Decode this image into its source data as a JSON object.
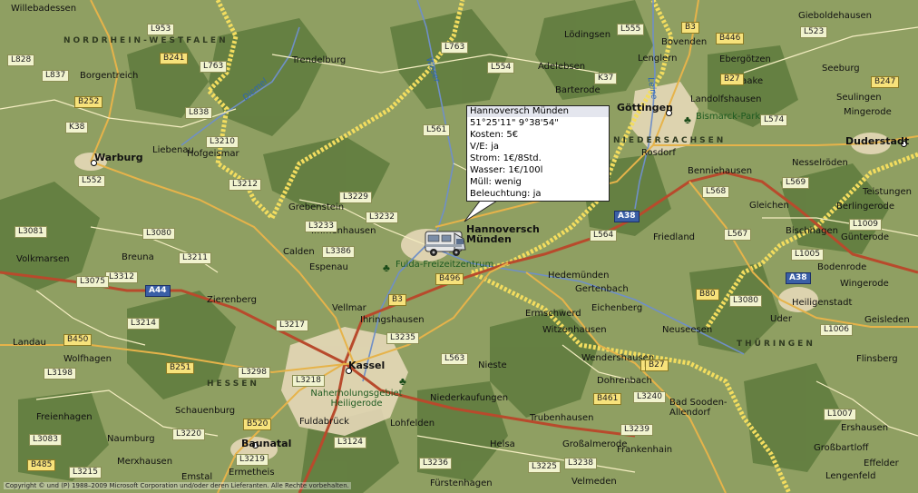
{
  "map": {
    "colors": {
      "lowland": "#8f9f62",
      "forest": "#5e7a3d",
      "urban": "#e6d8b8",
      "highway": "#b84a2c",
      "main_road": "#e6b34a",
      "minor_road": "#f5eec2",
      "river": "#6f8fc7",
      "border": "#f3dd5f"
    },
    "regions": [
      "NORDRHEIN-WESTFALEN",
      "NIEDERSACHSEN",
      "HESSEN",
      "THÜRINGEN"
    ],
    "cities": [
      {
        "name": "Willebadessen",
        "kind": "town"
      },
      {
        "name": "Borgentreich",
        "kind": "town"
      },
      {
        "name": "Trendelburg",
        "kind": "town"
      },
      {
        "name": "Liebenau",
        "kind": "town"
      },
      {
        "name": "Warburg",
        "kind": "city"
      },
      {
        "name": "Hofgeismar",
        "kind": "town"
      },
      {
        "name": "Grebenstein",
        "kind": "town"
      },
      {
        "name": "Immenhausen",
        "kind": "town"
      },
      {
        "name": "Calden",
        "kind": "town"
      },
      {
        "name": "Espenau",
        "kind": "town"
      },
      {
        "name": "Volkmarsen",
        "kind": "town"
      },
      {
        "name": "Breuna",
        "kind": "town"
      },
      {
        "name": "Zierenberg",
        "kind": "town"
      },
      {
        "name": "Vellmar",
        "kind": "town"
      },
      {
        "name": "Ihringshausen",
        "kind": "town"
      },
      {
        "name": "Landau",
        "kind": "town"
      },
      {
        "name": "Wolfhagen",
        "kind": "town"
      },
      {
        "name": "Kassel",
        "kind": "city"
      },
      {
        "name": "Niederkaufungen",
        "kind": "town"
      },
      {
        "name": "Nieste",
        "kind": "town"
      },
      {
        "name": "Freienhagen",
        "kind": "town"
      },
      {
        "name": "Schauenburg",
        "kind": "town"
      },
      {
        "name": "Fuldabrück",
        "kind": "town"
      },
      {
        "name": "Lohfelden",
        "kind": "town"
      },
      {
        "name": "Naumburg",
        "kind": "town"
      },
      {
        "name": "Baunatal",
        "kind": "city"
      },
      {
        "name": "Merxhausen",
        "kind": "town"
      },
      {
        "name": "Emstal",
        "kind": "town"
      },
      {
        "name": "Ermetheis",
        "kind": "town"
      },
      {
        "name": "Helsa",
        "kind": "town"
      },
      {
        "name": "Trubenhausen",
        "kind": "town"
      },
      {
        "name": "Großalmerode",
        "kind": "town"
      },
      {
        "name": "Fürstenhagen",
        "kind": "town"
      },
      {
        "name": "Velmeden",
        "kind": "town"
      },
      {
        "name": "Frankenhain",
        "kind": "town"
      },
      {
        "name": "Hannoversch Münden",
        "kind": "city"
      },
      {
        "name": "Hedemünden",
        "kind": "town"
      },
      {
        "name": "Gertenbach",
        "kind": "town"
      },
      {
        "name": "Ermschwerd",
        "kind": "town"
      },
      {
        "name": "Eichenberg",
        "kind": "town"
      },
      {
        "name": "Witzenhausen",
        "kind": "town"
      },
      {
        "name": "Wendershausen",
        "kind": "town"
      },
      {
        "name": "Dohrenbach",
        "kind": "town"
      },
      {
        "name": "Bad Sooden-Allendorf",
        "kind": "town"
      },
      {
        "name": "Neuseesen",
        "kind": "town"
      },
      {
        "name": "Friedland",
        "kind": "town"
      },
      {
        "name": "Rosdorf",
        "kind": "town"
      },
      {
        "name": "Göttingen",
        "kind": "city"
      },
      {
        "name": "Bovenden",
        "kind": "town"
      },
      {
        "name": "Lenglern",
        "kind": "town"
      },
      {
        "name": "Lödingsen",
        "kind": "town"
      },
      {
        "name": "Adelebsen",
        "kind": "town"
      },
      {
        "name": "Barterode",
        "kind": "town"
      },
      {
        "name": "Ebergötzen",
        "kind": "town"
      },
      {
        "name": "Waake",
        "kind": "town"
      },
      {
        "name": "Landolfshausen",
        "kind": "town"
      },
      {
        "name": "Gieboldehausen",
        "kind": "town"
      },
      {
        "name": "Seeburg",
        "kind": "town"
      },
      {
        "name": "Seulingen",
        "kind": "town"
      },
      {
        "name": "Mingerode",
        "kind": "town"
      },
      {
        "name": "Duderstadt",
        "kind": "city"
      },
      {
        "name": "Benniehausen",
        "kind": "town"
      },
      {
        "name": "Nesselröden",
        "kind": "town"
      },
      {
        "name": "Teistungen",
        "kind": "town"
      },
      {
        "name": "Gleichen",
        "kind": "town"
      },
      {
        "name": "Berlingerode",
        "kind": "town"
      },
      {
        "name": "Bischhagen",
        "kind": "town"
      },
      {
        "name": "Günterode",
        "kind": "town"
      },
      {
        "name": "Bodenrode",
        "kind": "town"
      },
      {
        "name": "Wingerode",
        "kind": "town"
      },
      {
        "name": "Heiligenstadt",
        "kind": "town"
      },
      {
        "name": "Uder",
        "kind": "town"
      },
      {
        "name": "Geisleden",
        "kind": "town"
      },
      {
        "name": "Flinsberg",
        "kind": "town"
      },
      {
        "name": "Ershausen",
        "kind": "town"
      },
      {
        "name": "Großbartloff",
        "kind": "town"
      },
      {
        "name": "Effelder",
        "kind": "town"
      },
      {
        "name": "Lengenfeld",
        "kind": "town"
      }
    ],
    "parks": [
      "Fulda-Freizeitzentrum",
      "Bismarck-Park",
      "Naherholungsgebiet Heiligerode"
    ],
    "rivers": [
      "Diemel",
      "Weser",
      "Leine"
    ],
    "shields": [
      {
        "text": "L953",
        "type": "l"
      },
      {
        "text": "K38",
        "type": "k"
      },
      {
        "text": "L828",
        "type": "l"
      },
      {
        "text": "B241",
        "type": "b"
      },
      {
        "text": "L837",
        "type": "l"
      },
      {
        "text": "B252",
        "type": "b"
      },
      {
        "text": "L838",
        "type": "l"
      },
      {
        "text": "L763",
        "type": "l"
      },
      {
        "text": "L3210",
        "type": "l"
      },
      {
        "text": "L552",
        "type": "l"
      },
      {
        "text": "L3212",
        "type": "l"
      },
      {
        "text": "L3229",
        "type": "l"
      },
      {
        "text": "L3232",
        "type": "l"
      },
      {
        "text": "L3233",
        "type": "l"
      },
      {
        "text": "L3081",
        "type": "l"
      },
      {
        "text": "L3080",
        "type": "l"
      },
      {
        "text": "L3386",
        "type": "l"
      },
      {
        "text": "L3211",
        "type": "l"
      },
      {
        "text": "L3312",
        "type": "l"
      },
      {
        "text": "L3075",
        "type": "l"
      },
      {
        "text": "A44",
        "type": "a"
      },
      {
        "text": "B3",
        "type": "b"
      },
      {
        "text": "L3214",
        "type": "l"
      },
      {
        "text": "L3217",
        "type": "l"
      },
      {
        "text": "B450",
        "type": "b"
      },
      {
        "text": "L3235",
        "type": "l"
      },
      {
        "text": "L3198",
        "type": "l"
      },
      {
        "text": "B251",
        "type": "b"
      },
      {
        "text": "L3298",
        "type": "l"
      },
      {
        "text": "L3218",
        "type": "l"
      },
      {
        "text": "B520",
        "type": "b"
      },
      {
        "text": "L3220",
        "type": "l"
      },
      {
        "text": "L3083",
        "type": "l"
      },
      {
        "text": "B485",
        "type": "b"
      },
      {
        "text": "L3219",
        "type": "l"
      },
      {
        "text": "L3215",
        "type": "l"
      },
      {
        "text": "L3124",
        "type": "l"
      },
      {
        "text": "L3236",
        "type": "l"
      },
      {
        "text": "L3225",
        "type": "l"
      },
      {
        "text": "L3238",
        "type": "l"
      },
      {
        "text": "L3239",
        "type": "l"
      },
      {
        "text": "B461",
        "type": "b"
      },
      {
        "text": "L3240",
        "type": "l"
      },
      {
        "text": "B27",
        "type": "b"
      },
      {
        "text": "L563",
        "type": "l"
      },
      {
        "text": "B496",
        "type": "b"
      },
      {
        "text": "L561",
        "type": "l"
      },
      {
        "text": "L554",
        "type": "l"
      },
      {
        "text": "K37",
        "type": "k"
      },
      {
        "text": "L555",
        "type": "l"
      },
      {
        "text": "B3",
        "type": "b"
      },
      {
        "text": "B446",
        "type": "b"
      },
      {
        "text": "L523",
        "type": "l"
      },
      {
        "text": "B27",
        "type": "b"
      },
      {
        "text": "L574",
        "type": "l"
      },
      {
        "text": "B247",
        "type": "b"
      },
      {
        "text": "L568",
        "type": "l"
      },
      {
        "text": "L569",
        "type": "l"
      },
      {
        "text": "A38",
        "type": "a"
      },
      {
        "text": "L564",
        "type": "l"
      },
      {
        "text": "L567",
        "type": "l"
      },
      {
        "text": "L1009",
        "type": "l"
      },
      {
        "text": "L1005",
        "type": "l"
      },
      {
        "text": "A38",
        "type": "a"
      },
      {
        "text": "B80",
        "type": "b"
      },
      {
        "text": "L3080",
        "type": "l"
      },
      {
        "text": "L1006",
        "type": "l"
      },
      {
        "text": "L1007",
        "type": "l"
      },
      {
        "text": "L763",
        "type": "l"
      },
      {
        "text": "B27",
        "type": "b"
      }
    ],
    "copyright": "Copyright © und (P) 1988–2009 Microsoft Corporation und/oder deren Lieferanten. Alle Rechte vorbehalten."
  },
  "popup": {
    "title": "Hannoversch Münden",
    "lines": [
      "51°25'11\" 9°38'54\"",
      "Kosten: 5€",
      "V/E: ja",
      "Strom: 1€/8Std.",
      "Wasser: 1€/100l",
      "Müll: wenig",
      "Beleuchtung: ja"
    ]
  },
  "marker": {
    "icon": "camper-van-icon"
  }
}
